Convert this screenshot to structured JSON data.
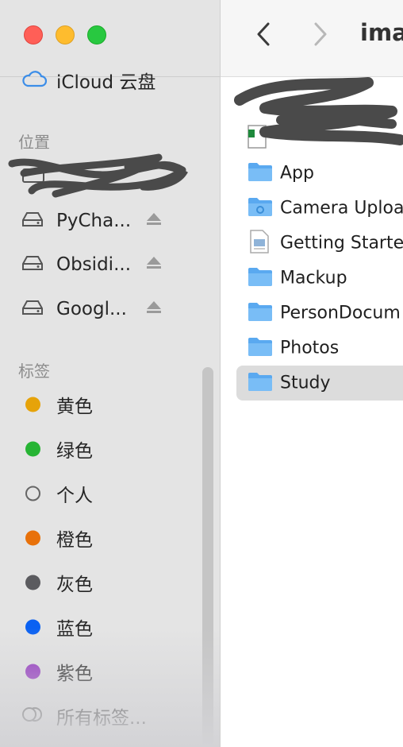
{
  "window": {
    "title": "imag"
  },
  "sidebar": {
    "icloud_label": "iCloud 云盘",
    "locations_title": "位置",
    "locations": [
      {
        "label": "PyCha...",
        "icon": "external-drive-icon",
        "ejectable": true
      },
      {
        "label": "Obsidi...",
        "icon": "external-drive-icon",
        "ejectable": true
      },
      {
        "label": "Googl...",
        "icon": "external-drive-icon",
        "ejectable": true
      }
    ],
    "tags_title": "标签",
    "tags": [
      {
        "label": "黄色",
        "color": "#e6a30a"
      },
      {
        "label": "绿色",
        "color": "#27b434"
      },
      {
        "label": "个人",
        "color": "none"
      },
      {
        "label": "橙色",
        "color": "#e8710a"
      },
      {
        "label": "灰色",
        "color": "#5b5b5f"
      },
      {
        "label": "蓝色",
        "color": "#0a61f2"
      },
      {
        "label": "紫色",
        "color": "#8f2bbf"
      }
    ],
    "all_tags_label": "所有标签..."
  },
  "files": [
    {
      "name": "App",
      "type": "folder",
      "selected": false
    },
    {
      "name": "Camera Uploa",
      "type": "folder-camera",
      "selected": false
    },
    {
      "name": "Getting Starte",
      "type": "document",
      "selected": false
    },
    {
      "name": "Mackup",
      "type": "folder",
      "selected": false
    },
    {
      "name": "PersonDocum",
      "type": "folder",
      "selected": false
    },
    {
      "name": "Photos",
      "type": "folder",
      "selected": false
    },
    {
      "name": "Study",
      "type": "folder",
      "selected": true
    }
  ],
  "colors": {
    "sidebar_bg": "#e4e4e4",
    "folder_blue": "#5aa9f0",
    "selection": "#dcdcdc"
  }
}
